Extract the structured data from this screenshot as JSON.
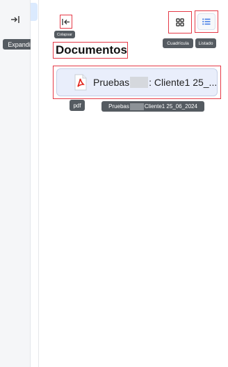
{
  "sidebar": {
    "expand_tooltip": "Expandir"
  },
  "header": {
    "collapse_tooltip": "Colapsar",
    "title": "Documentos",
    "grid_tooltip": "Cuadrícula",
    "list_tooltip": "Listado",
    "active_view": "list"
  },
  "files": [
    {
      "name_prefix": "Pruebas",
      "name_suffix": ": Cliente1 25_...",
      "type_tooltip": "pdf",
      "full_name_prefix": "Pruebas",
      "full_name_suffix": " Cliente1 25_06_2024",
      "icon": "pdf-file-icon"
    }
  ],
  "colors": {
    "highlight": "#e53946",
    "card_bg": "#e9eefb",
    "accent": "#2f6fe4",
    "tooltip_bg": "#555b61"
  }
}
